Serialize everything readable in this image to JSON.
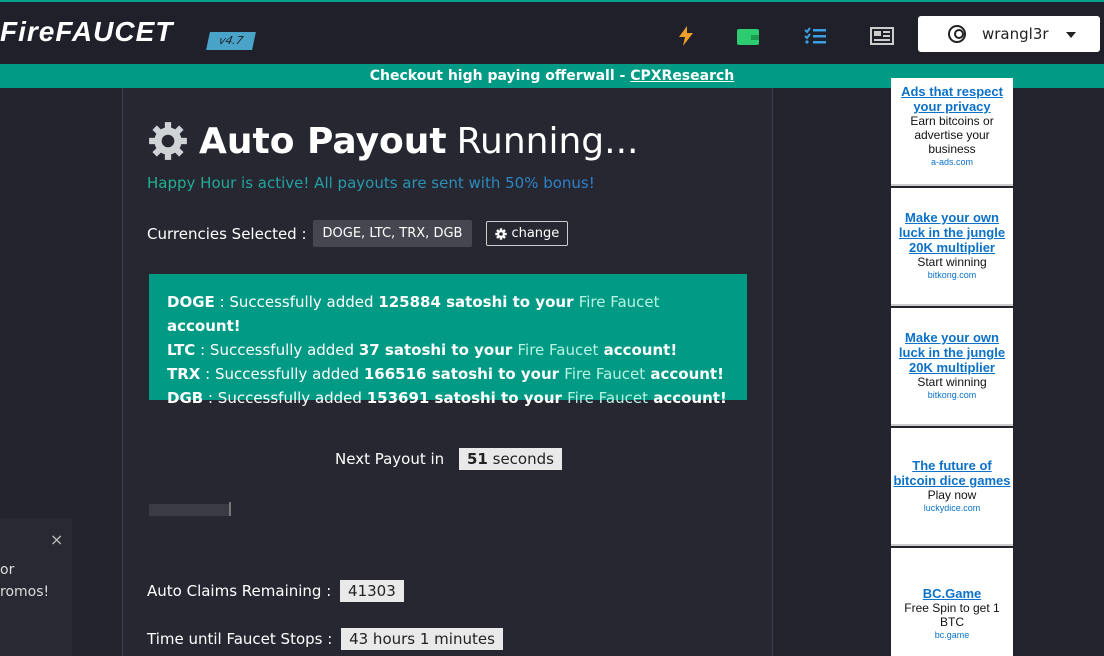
{
  "header": {
    "logo_fire": "Fire",
    "logo_faucet": "FAUCET",
    "version": "v4.7",
    "username": "wrangl3r",
    "icons": [
      "bolt-icon",
      "wallet-icon",
      "checklist-icon",
      "newspaper-icon",
      "user-circle-icon",
      "caret-down-icon"
    ],
    "accent": "#00a38a"
  },
  "banner": {
    "text": "Checkout high paying offerwall - ",
    "link": "CPXResearch"
  },
  "left_panel": {
    "close": "×",
    "line1": "or",
    "line2": "romos!"
  },
  "main": {
    "title_strong": "Auto Payout",
    "title_light": "Running...",
    "happy_hour": "Happy Hour is active! All payouts are sent with 50% bonus!",
    "currencies_label": "Currencies Selected :",
    "currencies_value": "DOGE, LTC, TRX, DGB",
    "change_label": "change",
    "payouts": [
      {
        "coin": "DOGE",
        "pre": " : Successfully added ",
        "amount": "125884 satoshi to your ",
        "site": "Fire Faucet",
        "post": " account!"
      },
      {
        "coin": "LTC",
        "pre": " : Successfully added ",
        "amount": "37 satoshi to your ",
        "site": "Fire Faucet",
        "post": " account!"
      },
      {
        "coin": "TRX",
        "pre": " : Successfully added ",
        "amount": "166516 satoshi to your ",
        "site": "Fire Faucet",
        "post": " account!"
      },
      {
        "coin": "DGB",
        "pre": " : Successfully added ",
        "amount": "153691 satoshi to your ",
        "site": "Fire Faucet",
        "post": " account!"
      }
    ],
    "next_label": "Next Payout in",
    "next_num": "51",
    "next_unit": "seconds",
    "claims_label": "Auto Claims Remaining :",
    "claims_value": "41303",
    "stops_label": "Time until Faucet Stops :",
    "stops_value": "43 hours 1 minutes"
  },
  "ads": [
    {
      "head": "Ads that respect your privacy",
      "sub": "Earn bitcoins or advertise your business",
      "domain": "a-ads.com"
    },
    {
      "head": "Make your own luck in the jungle 20K multiplier",
      "sub": "Start winning",
      "domain": "bitkong.com"
    },
    {
      "head": "Make your own luck in the jungle 20K multiplier",
      "sub": "Start winning",
      "domain": "bitkong.com"
    },
    {
      "head": "The future of bitcoin dice games",
      "sub": "Play now",
      "domain": "luckydice.com"
    },
    {
      "head": "BC.Game",
      "sub": "Free Spin to get 1 BTC",
      "domain": "bc.game"
    }
  ]
}
